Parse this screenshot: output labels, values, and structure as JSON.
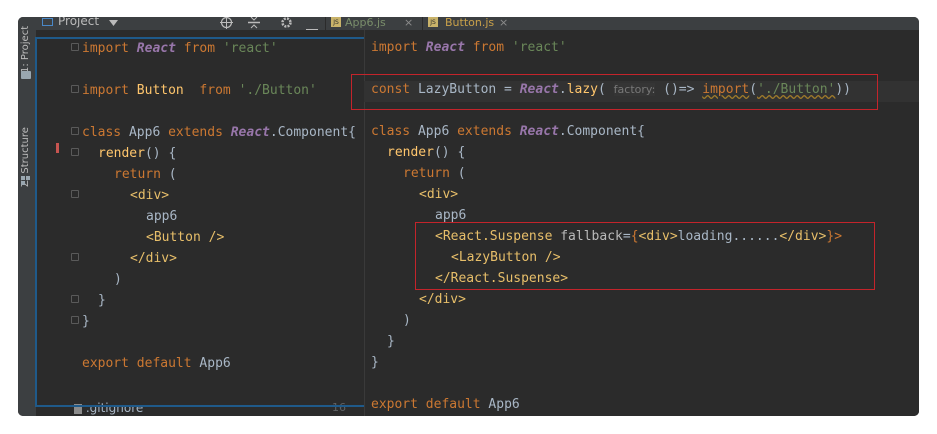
{
  "sidebar": {
    "project_tab": "1: Project",
    "structure_tab": "Z: Structure"
  },
  "toolbar": {
    "project_label": "Project",
    "tabs": [
      {
        "label": "App6.js",
        "color": "#7a8e6b"
      },
      {
        "label": "Button.js",
        "color": "#c9a14a"
      }
    ]
  },
  "left_pane": {
    "lines": [
      [
        "import ",
        "React",
        " from ",
        "'react'"
      ],
      [
        "import ",
        "Button",
        "  from ",
        "'./Button'"
      ],
      [
        "class ",
        "App6 ",
        "extends ",
        "React",
        ".Component{"
      ],
      [
        "render",
        "() {"
      ],
      [
        "return",
        " ("
      ],
      [
        "<div>"
      ],
      [
        "app6"
      ],
      [
        "<Button ",
        "/>"
      ],
      [
        "</div>"
      ],
      [
        ")"
      ],
      [
        "}"
      ],
      [
        "}"
      ],
      [
        "export ",
        "default ",
        "App6"
      ]
    ],
    "bottom_file": ".gitignore",
    "bottom_line_no": "16"
  },
  "right_pane": {
    "lines": [
      [
        "import ",
        "React",
        " from ",
        "'react'"
      ],
      [
        "const ",
        "LazyButton = ",
        "React",
        ".",
        "lazy",
        "( ",
        "factory:",
        " ()=> ",
        "import",
        "(",
        "'./Button'",
        "))"
      ],
      [
        "class ",
        "App6 ",
        "extends ",
        "React",
        ".Component{"
      ],
      [
        "render",
        "() {"
      ],
      [
        "return",
        " ("
      ],
      [
        "<div>"
      ],
      [
        "app6"
      ],
      [
        "<React.Suspense ",
        "fallback",
        "=",
        "{",
        "<div>",
        "loading......",
        "</div>",
        "}>"
      ],
      [
        "<LazyButton ",
        "/>"
      ],
      [
        "</React.Suspense>"
      ],
      [
        "</div>"
      ],
      [
        ")"
      ],
      [
        "}"
      ],
      [
        "}"
      ],
      [
        "export ",
        "default ",
        "App6"
      ]
    ]
  },
  "colors": {
    "background": "#2b2b2b",
    "keyword": "#cc7832",
    "string": "#6a8759",
    "class": "#9876aa",
    "function": "#ffc66d",
    "tag": "#e8bf6a",
    "highlight_box": "#c4242b",
    "panel_border": "#1f5a8a"
  },
  "icons": [
    "project-icon",
    "target-icon",
    "collapse-icon",
    "gear-icon",
    "minimize-icon",
    "js-file-icon",
    "close-icon",
    "folder-icon",
    "structure-icon"
  ]
}
